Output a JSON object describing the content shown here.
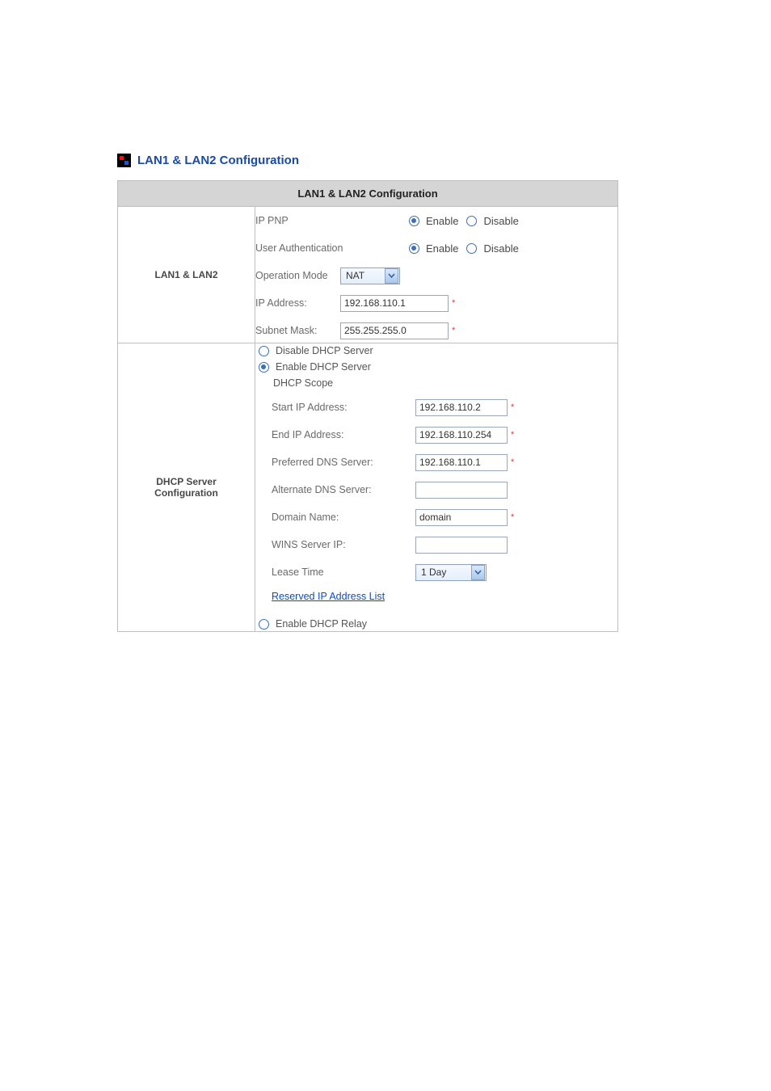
{
  "page": {
    "title": "LAN1 & LAN2 Configuration",
    "table_header": "LAN1 & LAN2 Configuration"
  },
  "lan": {
    "section_label": "LAN1 & LAN2",
    "ip_pnp_label": "IP PNP",
    "user_auth_label": "User Authentication",
    "enable_label": "Enable",
    "disable_label": "Disable",
    "operation_mode_label": "Operation Mode",
    "operation_mode_value": "NAT",
    "ip_address_label": "IP Address:",
    "ip_address_value": "192.168.110.1",
    "subnet_mask_label": "Subnet Mask:",
    "subnet_mask_value": "255.255.255.0"
  },
  "dhcp": {
    "section_label": "DHCP Server Configuration",
    "disable_server_label": "Disable DHCP Server",
    "enable_server_label": "Enable DHCP Server",
    "scope_label": "DHCP Scope",
    "start_ip_label": "Start IP Address:",
    "start_ip_value": "192.168.110.2",
    "end_ip_label": "End IP Address:",
    "end_ip_value": "192.168.110.254",
    "preferred_dns_label": "Preferred DNS Server:",
    "preferred_dns_value": "192.168.110.1",
    "alternate_dns_label": "Alternate DNS Server:",
    "alternate_dns_value": "",
    "domain_name_label": "Domain Name:",
    "domain_name_value": "domain",
    "wins_ip_label": "WINS Server IP:",
    "wins_ip_value": "",
    "lease_time_label": "Lease Time",
    "lease_time_value": "1 Day",
    "reserved_link_label": "Reserved IP Address List",
    "enable_relay_label": "Enable DHCP Relay"
  }
}
